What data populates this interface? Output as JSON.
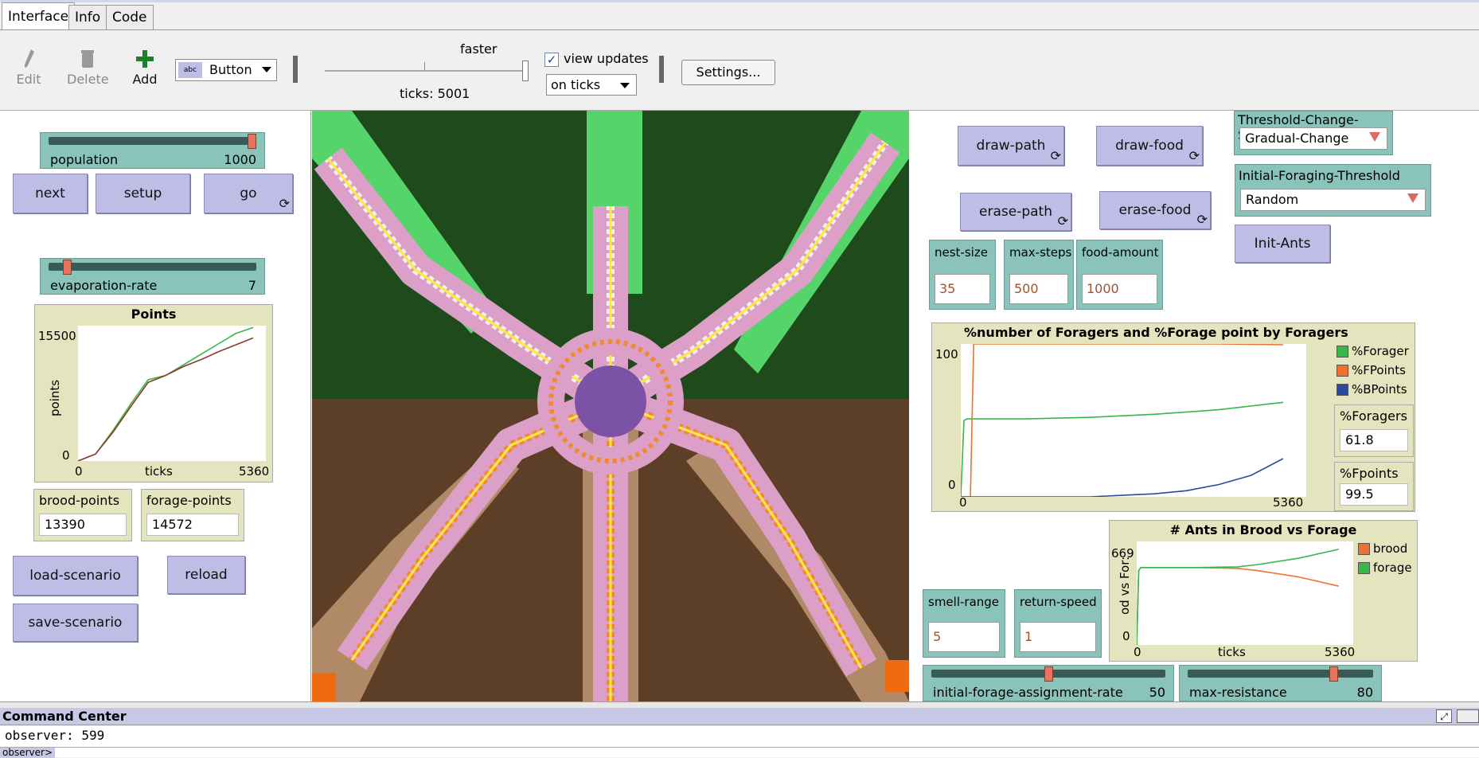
{
  "tabs": [
    {
      "label": "Interface"
    },
    {
      "label": "Info"
    },
    {
      "label": "Code"
    }
  ],
  "toolbar": {
    "edit": "Edit",
    "delete": "Delete",
    "add": "Add",
    "widget_type": "Button",
    "speed_label": "faster",
    "speed_value": 1.0,
    "ticks": "ticks: 5001",
    "view_updates": "view updates",
    "update_mode": "on ticks",
    "settings": "Settings..."
  },
  "left": {
    "population": {
      "label": "population",
      "value": "1000",
      "fraction": 1.0
    },
    "next": "next",
    "setup": "setup",
    "go": "go",
    "evaporation": {
      "label": "evaporation-rate",
      "value": "7",
      "fraction": 0.07
    },
    "brood_points": {
      "label": "brood-points",
      "value": "13390"
    },
    "forage_points": {
      "label": "forage-points",
      "value": "14572"
    },
    "load_scenario": "load-scenario",
    "reload": "reload",
    "save_scenario": "save-scenario"
  },
  "right": {
    "draw_path": "draw-path",
    "draw_food": "draw-food",
    "erase_path": "erase-path",
    "erase_food": "erase-food",
    "threshold_scheme": {
      "label": "Threshold-Change-Scheme",
      "value": "Gradual-Change"
    },
    "initial_threshold": {
      "label": "Initial-Foraging-Threshold",
      "value": "Random"
    },
    "init_ants": "Init-Ants",
    "nest_size": {
      "label": "nest-size",
      "value": "35"
    },
    "max_steps": {
      "label": "max-steps",
      "value": "500"
    },
    "food_amount": {
      "label": "food-amount",
      "value": "1000"
    },
    "smell_range": {
      "label": "smell-range",
      "value": "5"
    },
    "return_speed": {
      "label": "return-speed",
      "value": "1"
    },
    "pct_foragers": {
      "label": "%Foragers",
      "value": "61.8"
    },
    "pct_fpoints": {
      "label": "%Fpoints",
      "value": "99.5"
    },
    "init_forage_rate": {
      "label": "initial-forage-assignment-rate",
      "value": "50",
      "fraction": 0.5
    },
    "max_resistance": {
      "label": "max-resistance",
      "value": "80",
      "fraction": 0.8
    }
  },
  "command_center": {
    "title": "Command Center",
    "output": "observer: 599",
    "prompt": "observer>"
  },
  "colors": {
    "button": "#bdbde6",
    "slider": "#8ac3b9",
    "monitor": "#e4e4be",
    "grass": "#1e4a1c",
    "soil": "#5c3f26",
    "nest": "#7b52a6",
    "trail": "#dca0c8"
  },
  "chart_data": [
    {
      "type": "line",
      "title": "Points",
      "xlabel": "ticks",
      "ylabel": "points",
      "xlim": [
        0,
        5360
      ],
      "ylim": [
        0,
        15500
      ],
      "series": [
        {
          "color": "#39b54a",
          "x": [
            0,
            500,
            1000,
            1500,
            2000,
            2500,
            3000,
            3500,
            4000,
            4500,
            5000
          ],
          "y": [
            0,
            800,
            3500,
            6500,
            9300,
            9800,
            11000,
            12200,
            13400,
            14600,
            15300
          ]
        },
        {
          "color": "#8b3a2a",
          "x": [
            0,
            500,
            1000,
            1500,
            2000,
            2500,
            3000,
            3500,
            4000,
            4500,
            5000
          ],
          "y": [
            0,
            800,
            3300,
            6200,
            9000,
            9800,
            10800,
            11600,
            12500,
            13300,
            14100
          ]
        }
      ]
    },
    {
      "type": "line",
      "title": "%number of Foragers and %Forage point by Foragers",
      "xlim": [
        0,
        5360
      ],
      "ylim": [
        0,
        100
      ],
      "series": [
        {
          "name": "%Forager",
          "color": "#39b54a",
          "x": [
            0,
            50,
            100,
            1000,
            2000,
            3000,
            4000,
            5000
          ],
          "y": [
            0,
            50,
            51,
            51,
            52,
            54,
            57,
            61.8
          ]
        },
        {
          "name": "%FPoints",
          "color": "#f07030",
          "x": [
            0,
            150,
            200,
            1000,
            2000,
            3000,
            4000,
            5000
          ],
          "y": [
            0,
            0,
            100,
            100,
            100,
            100,
            100,
            99.5
          ]
        },
        {
          "name": "%BPoints",
          "color": "#2a4a9a",
          "x": [
            0,
            1000,
            2000,
            2500,
            3000,
            3500,
            4000,
            4500,
            5000
          ],
          "y": [
            0,
            0,
            0,
            1,
            2,
            4,
            8,
            14,
            25
          ]
        }
      ]
    },
    {
      "type": "line",
      "title": "# Ants in Brood vs Forage",
      "xlabel": "ticks",
      "ylabel": "od vs For:",
      "xlim": [
        0,
        5360
      ],
      "ylim": [
        0,
        669
      ],
      "series": [
        {
          "name": "brood",
          "color": "#f07030",
          "x": [
            0,
            50,
            100,
            1500,
            2500,
            3000,
            4000,
            5000
          ],
          "y": [
            0,
            480,
            500,
            500,
            495,
            480,
            440,
            380
          ]
        },
        {
          "name": "forage",
          "color": "#39b54a",
          "x": [
            0,
            50,
            100,
            1500,
            2500,
            3000,
            4000,
            5000
          ],
          "y": [
            0,
            480,
            500,
            500,
            505,
            520,
            560,
            618
          ]
        }
      ]
    }
  ]
}
